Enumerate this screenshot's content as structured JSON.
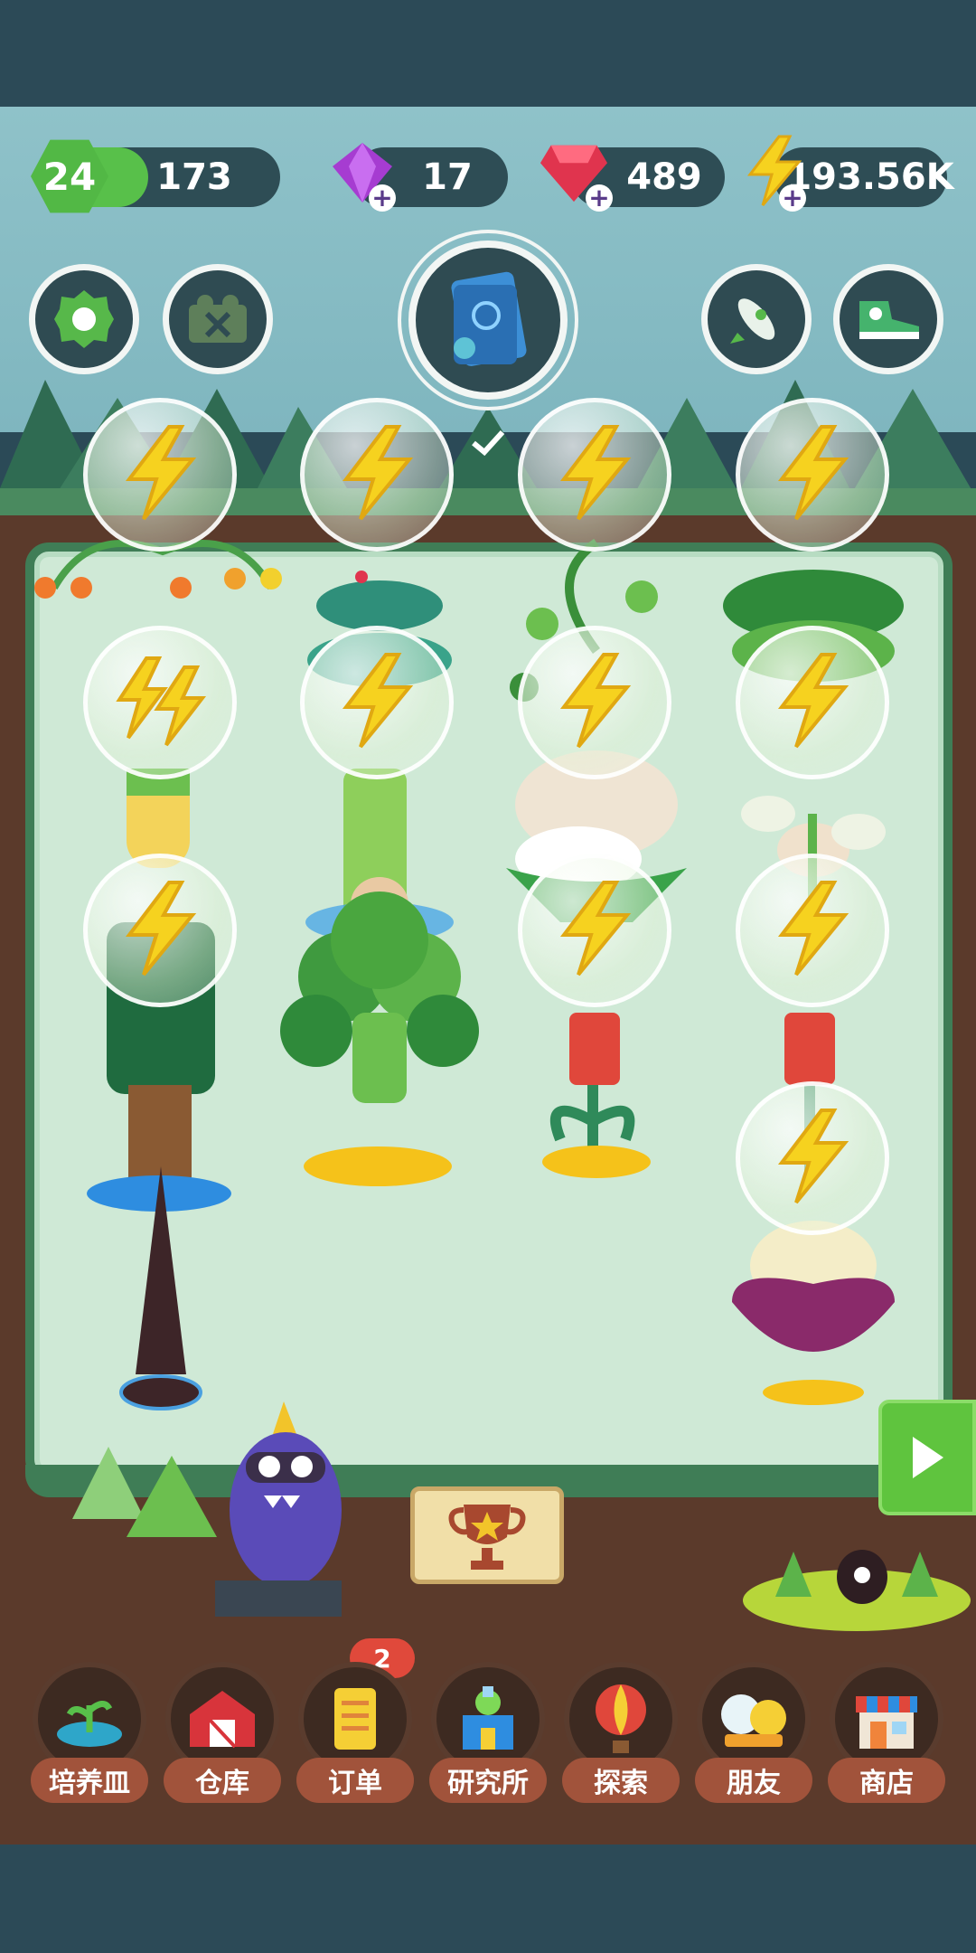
{
  "hud": {
    "level": "24",
    "xp": "173",
    "gems_purple": "17",
    "gems_red": "489",
    "energy": "193.56K"
  },
  "top_buttons": [
    {
      "name": "settings",
      "icon": "gear-icon"
    },
    {
      "name": "ads-off",
      "icon": "no-ads-icon"
    },
    {
      "name": "plant-book",
      "icon": "book-icon"
    },
    {
      "name": "rocket",
      "icon": "rocket-icon"
    },
    {
      "name": "sneaker",
      "icon": "sneaker-icon"
    }
  ],
  "garden": {
    "energy_bubble_count": 13
  },
  "bottom_nav": {
    "items": [
      {
        "label": "培养皿",
        "icon": "petri-dish-icon"
      },
      {
        "label": "仓库",
        "icon": "barn-icon"
      },
      {
        "label": "订单",
        "icon": "order-scroll-icon"
      },
      {
        "label": "研究所",
        "icon": "lab-icon"
      },
      {
        "label": "探索",
        "icon": "balloon-icon"
      },
      {
        "label": "朋友",
        "icon": "friends-icon"
      },
      {
        "label": "商店",
        "icon": "shop-icon"
      }
    ],
    "order_badge": "2"
  },
  "colors": {
    "accent_green": "#5fc43e",
    "board": "#cfe9d6",
    "soil": "#5b3a2b",
    "label_bg": "#a1533b"
  }
}
